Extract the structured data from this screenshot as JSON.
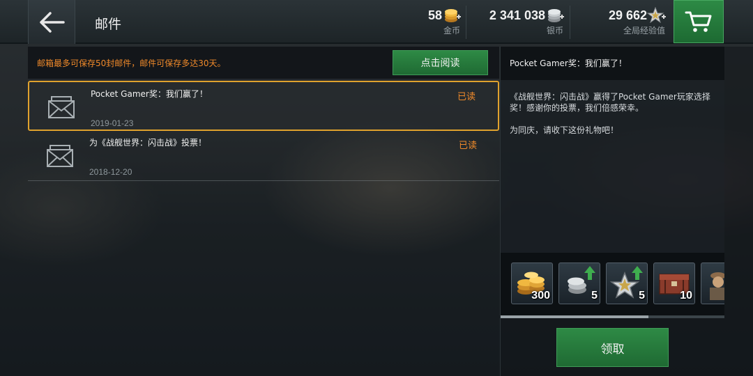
{
  "header": {
    "title": "邮件",
    "currencies": {
      "gold": {
        "value": "58",
        "label": "金币"
      },
      "silver": {
        "value": "2 341 038",
        "label": "银币"
      },
      "xp": {
        "value": "29 662",
        "label": "全局经验值"
      }
    },
    "icons": {
      "back": "arrow-left-icon",
      "cart": "cart-icon"
    }
  },
  "notice": {
    "text": "邮箱最多可保存50封邮件，邮件可保存多达30天。",
    "read_button": "点击阅读"
  },
  "mails": [
    {
      "subject": "Pocket Gamer奖：我们赢了！",
      "status": "已读",
      "date": "2019-01-23",
      "selected": true
    },
    {
      "subject": "为《战舰世界：闪击战》投票！",
      "status": "已读",
      "date": "2018-12-20",
      "selected": false
    }
  ],
  "detail": {
    "title": "Pocket Gamer奖：我们赢了！",
    "body": [
      "《战舰世界：闪击战》赢得了Pocket Gamer玩家选择奖！感谢你的投票，我们倍感荣幸。",
      "为同庆，请收下这份礼物吧！"
    ],
    "rewards": [
      {
        "icon": "gold-coins-icon",
        "qty": "300"
      },
      {
        "icon": "silver-boost-icon",
        "qty": "5"
      },
      {
        "icon": "xp-boost-icon",
        "qty": "5"
      },
      {
        "icon": "container-icon",
        "qty": "10"
      },
      {
        "icon": "commander-icon",
        "qty": ""
      }
    ],
    "claim_button": "领取"
  },
  "colors": {
    "accent_orange": "#f08a2a",
    "button_green": "#2e8a45",
    "selection_border": "#e0a22d"
  }
}
